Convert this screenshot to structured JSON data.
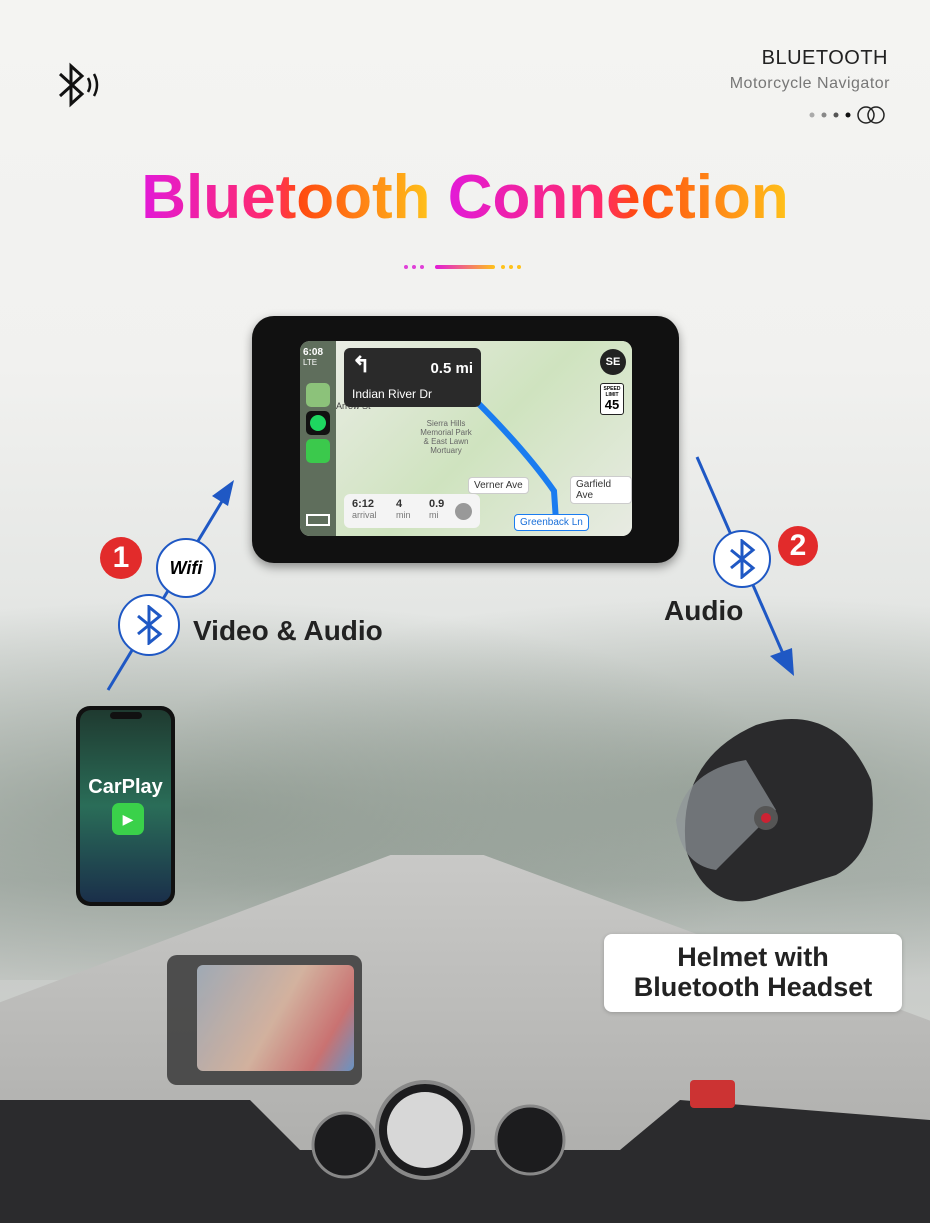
{
  "header": {
    "title": "BLUETOOTH",
    "subtitle": "Motorcycle Navigator",
    "logo_icon": "bluetooth-sound-icon"
  },
  "main_title": {
    "word1": "Bluetooth",
    "word2": "Connection"
  },
  "colors": {
    "title_gradient": [
      "#e21ad8",
      "#ff4a10",
      "#ffc21a"
    ],
    "arrow": "#1f58c4",
    "badge": "#e22b2b"
  },
  "device_screen": {
    "time": "6:08",
    "signal": "LTE",
    "maneuver_distance": "0.5 mi",
    "street": "Indian River Dr",
    "compass": "SE",
    "speed_limit": {
      "label1": "SPEED",
      "label2": "LIMIT",
      "value": "45"
    },
    "poi": "Sierra Hills Memorial Park & East Lawn Mortuary",
    "street_partial": "Arrow St",
    "labels": [
      "Verner Ave",
      "Garfield Ave",
      "Greenback Ln"
    ],
    "eta": [
      {
        "value": "6:12",
        "unit": "arrival"
      },
      {
        "value": "4",
        "unit": "min"
      },
      {
        "value": "0.9",
        "unit": "mi"
      }
    ]
  },
  "left_connection": {
    "badge": "1",
    "wifi_label": "Wifi",
    "label": "Video & Audio"
  },
  "right_connection": {
    "badge": "2",
    "label": "Audio"
  },
  "phone": {
    "label": "CarPlay"
  },
  "helmet": {
    "line1": "Helmet with",
    "line2": "Bluetooth Headset"
  }
}
